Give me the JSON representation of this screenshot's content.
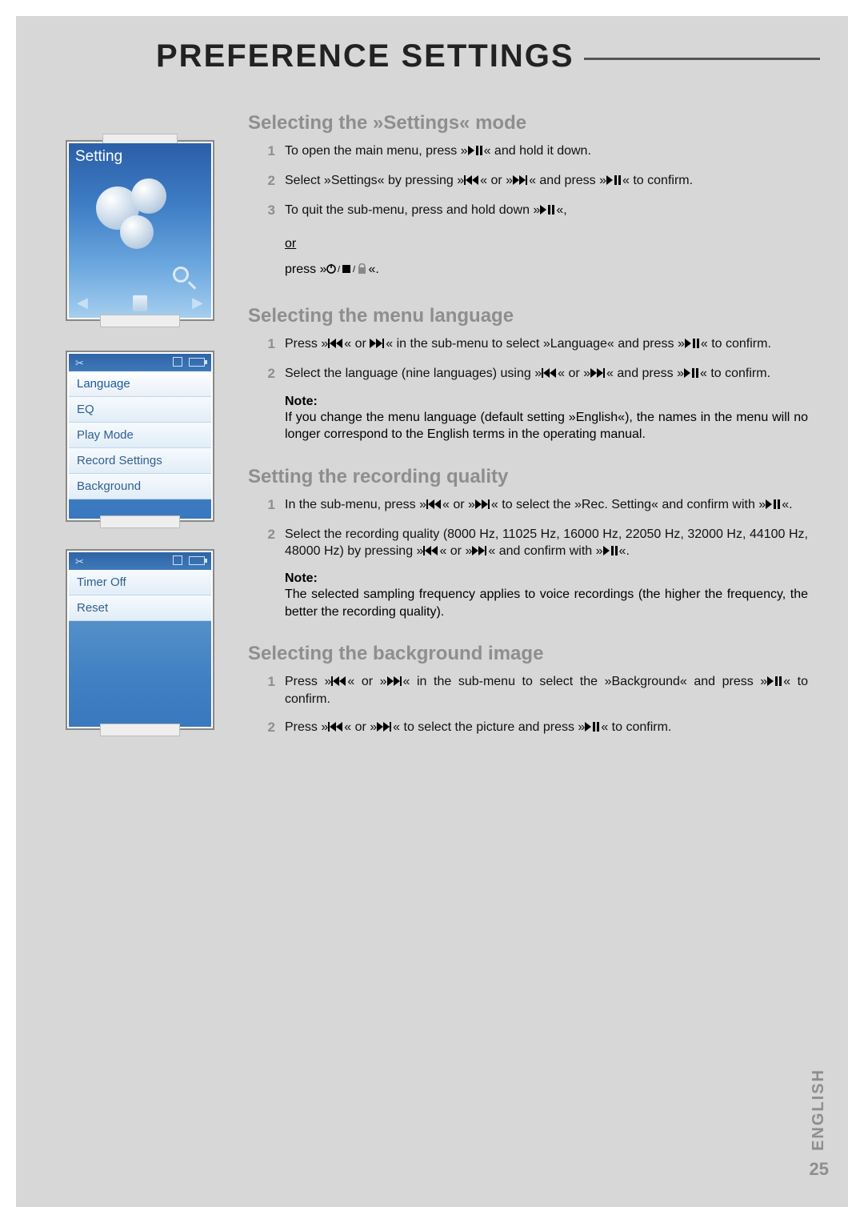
{
  "title": "PREFERENCE SETTINGS",
  "page_number": "25",
  "language_tab": "ENGLISH",
  "shots": {
    "setting_label": "Setting",
    "menu1": [
      "Language",
      "EQ",
      "Play Mode",
      "Record Settings",
      "Background"
    ],
    "menu2": [
      "Timer Off",
      "Reset"
    ]
  },
  "sections": [
    {
      "heading": "Selecting the »Settings« mode",
      "items": [
        {
          "num": "1",
          "pre": "To open the main menu, press »",
          "icon": "playpause",
          "post": "« and hold it down."
        },
        {
          "num": "2",
          "pre": "Select »Settings« by pressing »",
          "icon": "prev",
          "mid1": "« or »",
          "icon2": "next",
          "mid2": "« and press »",
          "icon3": "playpause",
          "post": "« to confirm."
        },
        {
          "num": "3",
          "pre": "To quit the sub-menu, press and hold down »",
          "icon": "playpause",
          "post": "«,"
        }
      ],
      "or_line1": "or",
      "or_line2_pre": "press »",
      "or_line2_icon": "powerstoplock",
      "or_line2_post": "«."
    },
    {
      "heading": "Selecting the menu language",
      "items": [
        {
          "num": "1",
          "pre": "Press »",
          "icon": "prev",
          "mid1": "« or ",
          "icon2": "next",
          "mid2": "« in the sub-menu to select »Language« and press »",
          "icon3": "playpause",
          "post": "« to confirm."
        },
        {
          "num": "2",
          "pre": "Select the language (nine languages) using »",
          "icon": "prev",
          "mid1": "« or »",
          "icon2": "next",
          "mid2": "« and press »",
          "icon3": "playpause",
          "post": "« to confirm."
        }
      ],
      "note_label": "Note:",
      "note_body": "If you change the menu language (default setting »English«), the names in the menu will no longer correspond to the English terms in the operating manual."
    },
    {
      "heading": "Setting the recording quality",
      "items": [
        {
          "num": "1",
          "pre": "In the sub-menu, press »",
          "icon": "prev",
          "mid1": "« or »",
          "icon2": "next",
          "mid2": "« to select the »Rec. Setting« and confirm with »",
          "icon3": "playpause",
          "post": "«."
        },
        {
          "num": "2",
          "pre": "Select the recording quality (8000 Hz, 11025 Hz, 16000 Hz, 22050 Hz, 32000 Hz, 44100 Hz, 48000 Hz) by pressing »",
          "icon": "prev",
          "mid1": "« or »",
          "icon2": "next",
          "mid2": "« and confirm with »",
          "icon3": "playpause",
          "post": "«."
        }
      ],
      "note_label": "Note:",
      "note_body": "The selected sampling frequency applies to voice recordings (the higher the frequency, the better the recording quality)."
    },
    {
      "heading": "Selecting the background image",
      "items": [
        {
          "num": "1",
          "pre": "Press »",
          "icon": "prev",
          "mid1": "« or »",
          "icon2": "next",
          "mid2": "« in the sub-menu to select the »Background« and press »",
          "icon3": "playpause",
          "post": "« to confirm."
        },
        {
          "num": "2",
          "pre": "Press »",
          "icon": "prev",
          "mid1": "« or »",
          "icon2": "next",
          "mid2": "« to select the picture and press »",
          "icon3": "playpause",
          "post": "« to confirm."
        }
      ]
    }
  ]
}
